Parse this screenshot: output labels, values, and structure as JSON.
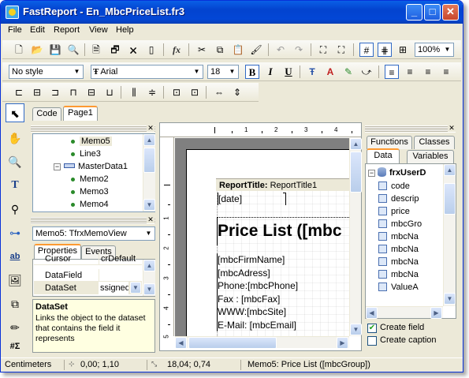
{
  "window": {
    "title": "FastReport - En_MbcPriceList.fr3"
  },
  "menu": [
    "File",
    "Edit",
    "Report",
    "View",
    "Help"
  ],
  "toolbar1": {
    "zoom": "100%"
  },
  "toolbar2": {
    "style": "No style",
    "font": "Arial",
    "size": "18"
  },
  "editor_tabs": [
    "Code",
    "Page1"
  ],
  "tree": {
    "items": [
      "Memo5",
      "Line3",
      "MasterData1",
      "Memo2",
      "Memo3",
      "Memo4"
    ]
  },
  "object_combo": "Memo5: TfrxMemoView",
  "props_tabs": [
    "Properties",
    "Events"
  ],
  "props": {
    "cursor_label": "Cursor",
    "cursor_value": "crDefault",
    "datafield_label": "DataField",
    "dataset_label": "DataSet",
    "dataset_value": "ssigned)"
  },
  "help": {
    "title": "DataSet",
    "text": "Links the object to the dataset that contains the field it represents"
  },
  "ruler": {
    "top": [
      "1",
      "2",
      "3",
      "4"
    ],
    "left": [
      "1",
      "2",
      "3",
      "4",
      "5"
    ]
  },
  "report": {
    "band_label": "ReportTitle:",
    "band_name": "ReportTitle1",
    "date": "[date]",
    "heading": "Price List ([mbc",
    "lines": [
      "[mbcFirmName]",
      "[mbcAdress]",
      "Phone:[mbcPhone]",
      "Fax : [mbcFax]",
      "WWW:[mbcSite]",
      "E-Mail: [mbcEmail]"
    ]
  },
  "data_panel": {
    "tabs_top": [
      "Functions",
      "Classes"
    ],
    "tabs_bottom": [
      "Data",
      "Variables"
    ],
    "root": "frxUserD",
    "fields": [
      "code",
      "descrip",
      "price",
      "mbcGro",
      "mbcNa",
      "mbcNa",
      "mbcNa",
      "mbcNa",
      "ValueA"
    ],
    "create_field": "Create field",
    "create_caption": "Create caption"
  },
  "status": {
    "units": "Centimeters",
    "position": "0,00; 1,10",
    "size": "18,04; 0,74",
    "selection": "Memo5: Price List ([mbcGroup])"
  }
}
